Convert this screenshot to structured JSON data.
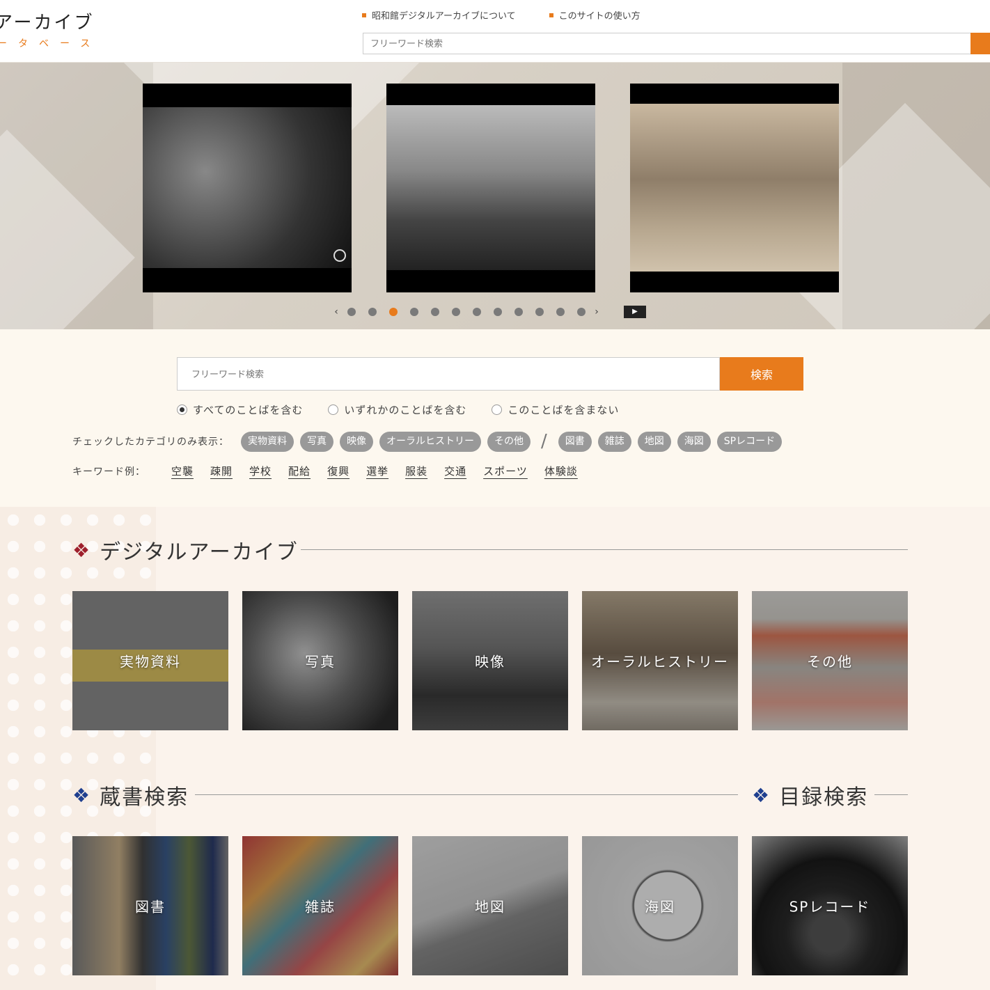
{
  "header": {
    "logo_main": "アーカイブ",
    "logo_sub": "ータベース",
    "nav": [
      {
        "label": "昭和館デジタルアーカイブについて"
      },
      {
        "label": "このサイトの使い方"
      }
    ],
    "search_placeholder": "フリーワード検索"
  },
  "slider": {
    "pages": 12,
    "active_index": 3
  },
  "search": {
    "placeholder": "フリーワード検索",
    "button_label": "検索",
    "options": [
      {
        "label": "すべてのことばを含む",
        "selected": true
      },
      {
        "label": "いずれかのことばを含む",
        "selected": false
      },
      {
        "label": "このことばを含まない",
        "selected": false
      }
    ],
    "category_label": "チェックしたカテゴリのみ表示：",
    "categories_a": [
      "実物資料",
      "写真",
      "映像",
      "オーラルヒストリー",
      "その他"
    ],
    "separator": "/",
    "categories_b": [
      "図書",
      "雑誌",
      "地図",
      "海図",
      "SPレコード"
    ],
    "keyword_label": "キーワード例：",
    "keywords": [
      "空襲",
      "疎開",
      "学校",
      "配給",
      "復興",
      "選挙",
      "服装",
      "交通",
      "スポーツ",
      "体験談"
    ]
  },
  "digital_archive": {
    "title": "デジタルアーカイブ",
    "tiles": [
      "実物資料",
      "写真",
      "映像",
      "オーラルヒストリー",
      "その他"
    ]
  },
  "library_search": {
    "title": "蔵書検索",
    "tiles": [
      "図書",
      "雑誌",
      "地図",
      "海図"
    ]
  },
  "catalog_search": {
    "title": "目録検索",
    "tiles": [
      "SPレコード"
    ]
  },
  "colors": {
    "accent": "#e87b1c",
    "diamond_red": "#9e1f2c",
    "diamond_blue": "#1f3f8f",
    "pill_bg": "#999999"
  }
}
